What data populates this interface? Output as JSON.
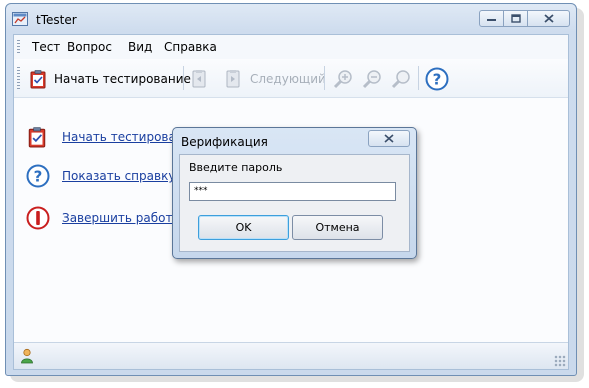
{
  "window": {
    "title": "tTester"
  },
  "menu": [
    {
      "label": "Тест"
    },
    {
      "label": "Вопрос"
    },
    {
      "label": "Вид"
    },
    {
      "label": "Справка"
    }
  ],
  "toolbar": {
    "start_label": "Начать тестирование",
    "next_label": "Следующий"
  },
  "links": {
    "start": "Начать тестирование",
    "help": "Показать справку по программе",
    "exit": "Завершить работу с программой"
  },
  "dialog": {
    "title": "Верификация",
    "prompt": "Введите пароль",
    "password_value": "***",
    "ok_label": "OK",
    "cancel_label": "Отмена"
  },
  "colors": {
    "link": "#1a3fa0",
    "accent_blue": "#2d6fc0",
    "exit_red": "#c91f1f"
  }
}
